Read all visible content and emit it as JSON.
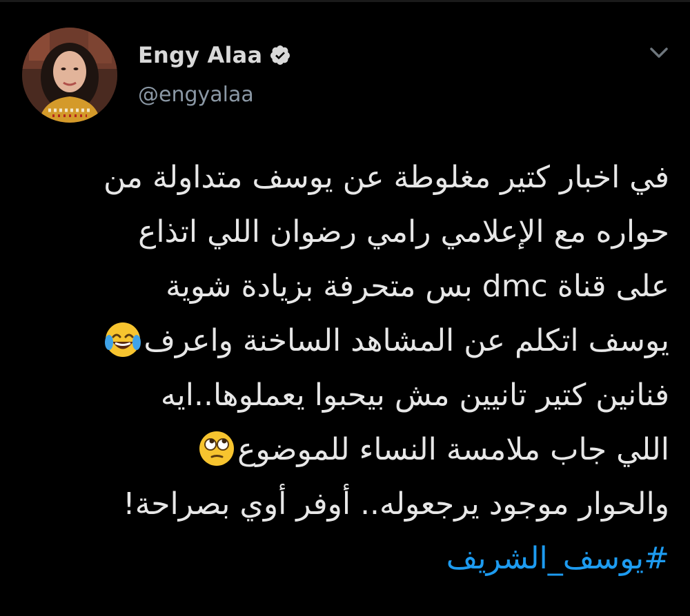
{
  "user": {
    "display_name": "Engy Alaa",
    "handle": "@engyalaa",
    "verified": true,
    "verified_icon": "verified-badge-icon",
    "avatar_icon": "profile-photo"
  },
  "menu": {
    "icon": "chevron-down-icon"
  },
  "tweet": {
    "lines": [
      "في اخبار كتير مغلوطة عن يوسف متداولة من",
      "حواره مع الإعلامي رامي رضوان اللي اتذاع",
      "على قناة dmc بس متحرفة بزيادة شوية",
      "يوسف اتكلم عن المشاهد الساخنة واعرف",
      "فنانين كتير تانيين مش بيحبوا يعملوها..ايه",
      "اللي جاب ملامسة النساء للموضوع",
      "والحوار موجود يرجعوله.. أوفر أوي بصراحة!"
    ],
    "hashtag": "#يوسف_الشريف",
    "emojis": {
      "line4": "face-with-tears-of-joy-emoji",
      "line6": "face-with-rolling-eyes-emoji"
    }
  },
  "colors": {
    "background": "#000000",
    "text": "#e7e7e7",
    "secondary_text": "#8b98a5",
    "accent_link": "#1d9bf0",
    "verified_badge": "#d9d9d9"
  }
}
